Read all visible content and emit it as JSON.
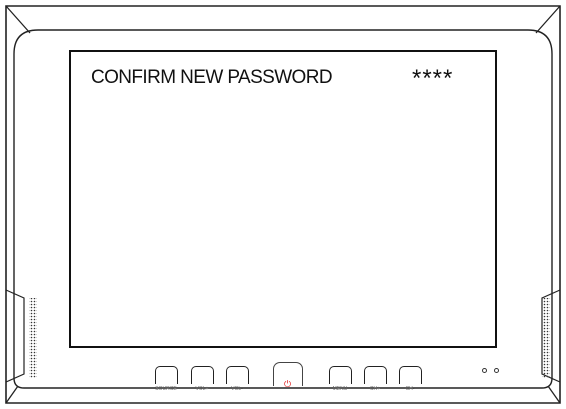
{
  "screen": {
    "prompt_text": "CONFIRM NEW PASSWORD",
    "password_mask": "****"
  },
  "front_panel": {
    "buttons": [
      {
        "label": "SOURCE",
        "icon": "source-button"
      },
      {
        "label": "VOL+",
        "icon": "volume-up-button"
      },
      {
        "label": "VOL-",
        "icon": "volume-down-button"
      },
      {
        "label": "MENU",
        "icon": "menu-button"
      },
      {
        "label": "CH+",
        "icon": "channel-up-button"
      },
      {
        "label": "CH-",
        "icon": "channel-down-button"
      }
    ],
    "power_icon": "power-icon",
    "power_color": "#e01a1a",
    "sensors": [
      "ir-sensor",
      "power-led"
    ]
  }
}
